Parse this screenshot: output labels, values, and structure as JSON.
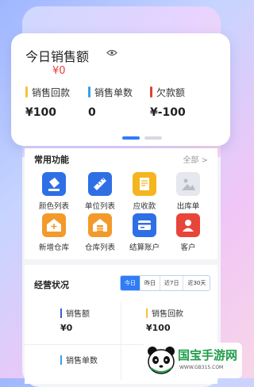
{
  "sales": {
    "title": "今日销售额",
    "amount": "¥0",
    "stats": [
      {
        "label": "销售回款",
        "value": "¥100",
        "color": "#f5c43a"
      },
      {
        "label": "销售单数",
        "value": "0",
        "color": "#3aa0e8"
      },
      {
        "label": "欠款额",
        "value": "¥-100",
        "color": "#d9452f"
      }
    ]
  },
  "functions": {
    "title": "常用功能",
    "more": "全部 >",
    "items": [
      {
        "label": "颜色列表",
        "icon": "paint-bucket-icon",
        "color": "#2f6fe6"
      },
      {
        "label": "单位列表",
        "icon": "ruler-icon",
        "color": "#2f6fe6"
      },
      {
        "label": "应收款",
        "icon": "receivable-doc-icon",
        "color": "#f4b51e"
      },
      {
        "label": "出库单",
        "icon": "image-placeholder-icon",
        "color": "#e6e8ee"
      },
      {
        "label": "新增仓库",
        "icon": "add-warehouse-icon",
        "color": "#f39a2b"
      },
      {
        "label": "仓库列表",
        "icon": "warehouse-icon",
        "color": "#f39a2b"
      },
      {
        "label": "结算账户",
        "icon": "account-icon",
        "color": "#2f6fe6"
      },
      {
        "label": "客户",
        "icon": "customer-icon",
        "color": "#e8453a"
      }
    ]
  },
  "business": {
    "title": "经营状况",
    "tabs": [
      "今日",
      "昨日",
      "近7日",
      "近30天"
    ],
    "active_tab": "今日",
    "stats": [
      {
        "label": "销售额",
        "value": "¥0",
        "color": "#3b5bd6"
      },
      {
        "label": "销售回款",
        "value": "¥100",
        "color": "#f5c43a"
      },
      {
        "label": "销售单数",
        "value": "",
        "color": "#3aa0e8"
      }
    ]
  },
  "watermark": {
    "name": "国宝手游网",
    "url": "WWW.GB315.COM"
  }
}
